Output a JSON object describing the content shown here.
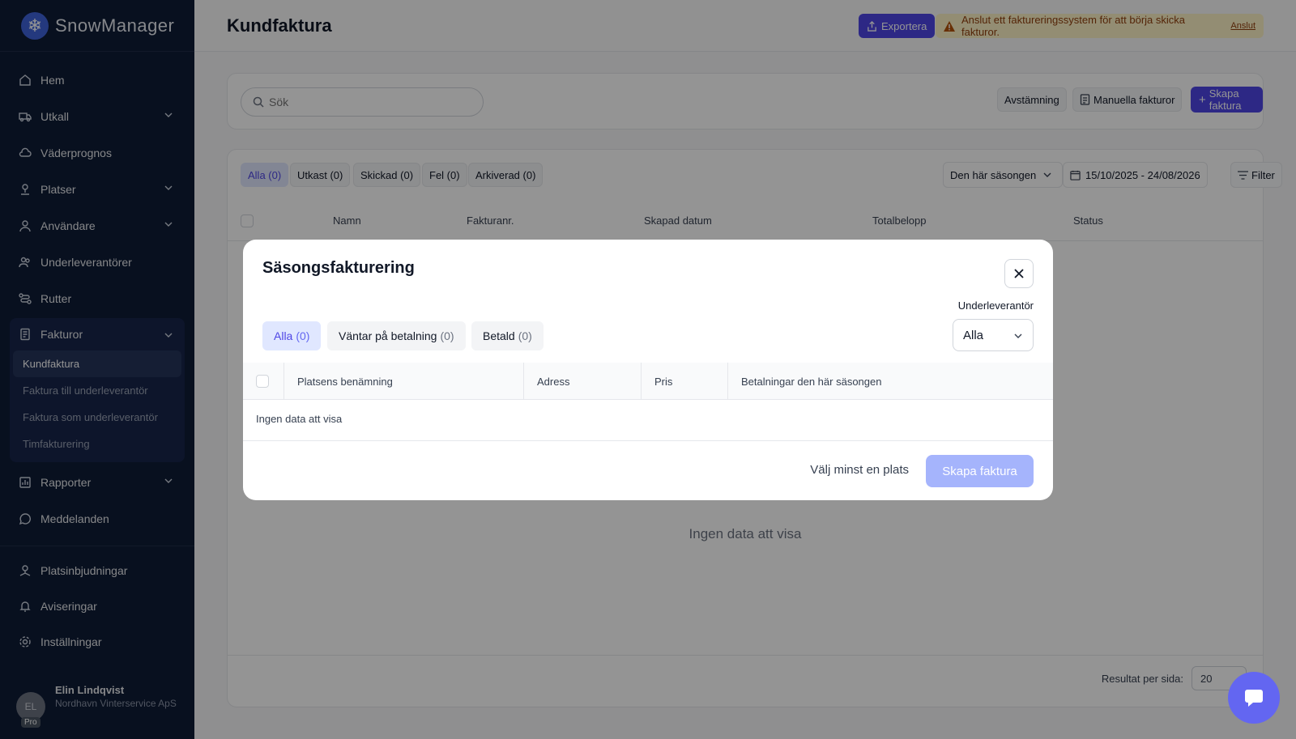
{
  "brand": {
    "name": "SnowManager"
  },
  "sidebar": {
    "items": [
      {
        "label": "Hem",
        "icon": "home-icon"
      },
      {
        "label": "Utkall",
        "icon": "truck-icon"
      },
      {
        "label": "Väderprognos",
        "icon": "cloud-icon"
      },
      {
        "label": "Platser",
        "icon": "map-pin-icon"
      },
      {
        "label": "Användare",
        "icon": "user-icon"
      },
      {
        "label": "Underleverantörer",
        "icon": "users-icon"
      },
      {
        "label": "Rutter",
        "icon": "route-icon"
      }
    ],
    "invoices": {
      "label": "Fakturor",
      "sub": [
        "Kundfaktura",
        "Faktura till underleverantör",
        "Faktura som underleverantör",
        "Timfakturering"
      ]
    },
    "more": [
      {
        "label": "Rapporter"
      },
      {
        "label": "Meddelanden"
      }
    ],
    "bottom": [
      {
        "label": "Platsinbjudningar"
      },
      {
        "label": "Aviseringar"
      },
      {
        "label": "Inställningar"
      }
    ],
    "user": {
      "initials": "EL",
      "badge": "Pro",
      "name": "Elin Lindqvist",
      "company": "Nordhavn Vinterservice ApS"
    }
  },
  "header": {
    "title": "Kundfaktura",
    "export_label": "Exportera",
    "warning_text": "Anslut ett faktureringssystem för att börja skicka fakturor.",
    "warning_link": "Anslut"
  },
  "toolbar": {
    "search_placeholder": "Sök",
    "reconcile_label": "Avstämning",
    "manual_label": "Manuella fakturor",
    "create_label": "Skapa faktura"
  },
  "tabs": [
    "Alla (0)",
    "Utkast (0)",
    "Skickad (0)",
    "Fel (0)",
    "Arkiverad (0)"
  ],
  "filters": {
    "season": "Den här säsongen",
    "date_range": "15/10/2025 - 24/08/2026",
    "filter_label": "Filter"
  },
  "table": {
    "columns": [
      "Namn",
      "Fakturanr.",
      "Skapad datum",
      "Totalbelopp",
      "Status"
    ],
    "empty": "Ingen data att visa"
  },
  "pagination": {
    "label": "Resultat per sida:",
    "value": "20"
  },
  "modal": {
    "title": "Säsongsfakturering",
    "tabs": [
      {
        "label": "Alla",
        "count": "(0)"
      },
      {
        "label": "Väntar på betalning",
        "count": "(0)"
      },
      {
        "label": "Betald",
        "count": "(0)"
      }
    ],
    "subcontractor_label": "Underleverantör",
    "subcontractor_value": "Alla",
    "columns": [
      "Platsens benämning",
      "Adress",
      "Pris",
      "Betalningar den här säsongen"
    ],
    "empty": "Ingen data att visa",
    "hint": "Välj minst en plats",
    "create_label": "Skapa faktura"
  },
  "colors": {
    "accent": "#4f46e5",
    "sidebar": "#0f1c36",
    "warning_bg": "#fef3c7"
  }
}
